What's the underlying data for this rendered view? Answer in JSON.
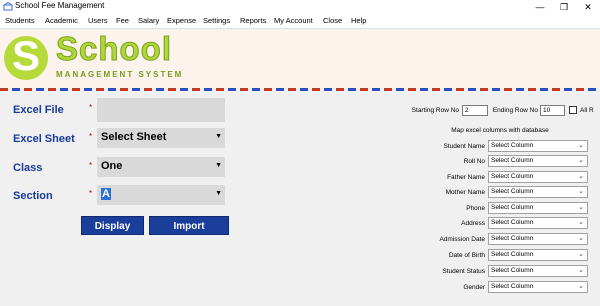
{
  "window": {
    "title": "School Fee Management",
    "minimize": "—",
    "maximize": "❐",
    "close": "✕"
  },
  "menu": [
    "Students",
    "Academic",
    "Users",
    "Fee",
    "Salary",
    "Expense",
    "Settings",
    "Reports",
    "My Account",
    "Close",
    "Help"
  ],
  "logo": {
    "letter": "S",
    "title": "School",
    "subtitle": "MANAGEMENT SYSTEM",
    "accent": "#b0d63e"
  },
  "form": {
    "excel_file_label": "Excel File",
    "excel_sheet_label": "Excel Sheet",
    "excel_sheet_value": "Select Sheet",
    "class_label": "Class",
    "class_value": "One",
    "section_label": "Section",
    "section_value": "A",
    "required_mark": "*",
    "display_button": "Display",
    "import_button": "Import"
  },
  "mapping": {
    "starting_row_label": "Starting Row No",
    "starting_row_value": "2",
    "ending_row_label": "Ending Row No",
    "ending_row_value": "10",
    "all_label": "All R",
    "heading": "Map excel columns with database",
    "rows": [
      {
        "label": "Student Name",
        "value": "Select Column"
      },
      {
        "label": "Roll No",
        "value": "Select Column"
      },
      {
        "label": "Father Name",
        "value": "Select Column"
      },
      {
        "label": "Mother Name",
        "value": "Select Column"
      },
      {
        "label": "Phone",
        "value": "Select Column"
      },
      {
        "label": "Address",
        "value": "Select Column"
      },
      {
        "label": "Admission Date",
        "value": "Select Column"
      },
      {
        "label": "Date of Birth",
        "value": "Select Column"
      },
      {
        "label": "Student Status",
        "value": "Select Column"
      },
      {
        "label": "Gender",
        "value": "Select Column"
      }
    ]
  },
  "colors": {
    "label_blue": "#1a3a9c",
    "button_blue": "#1b3e9a"
  }
}
